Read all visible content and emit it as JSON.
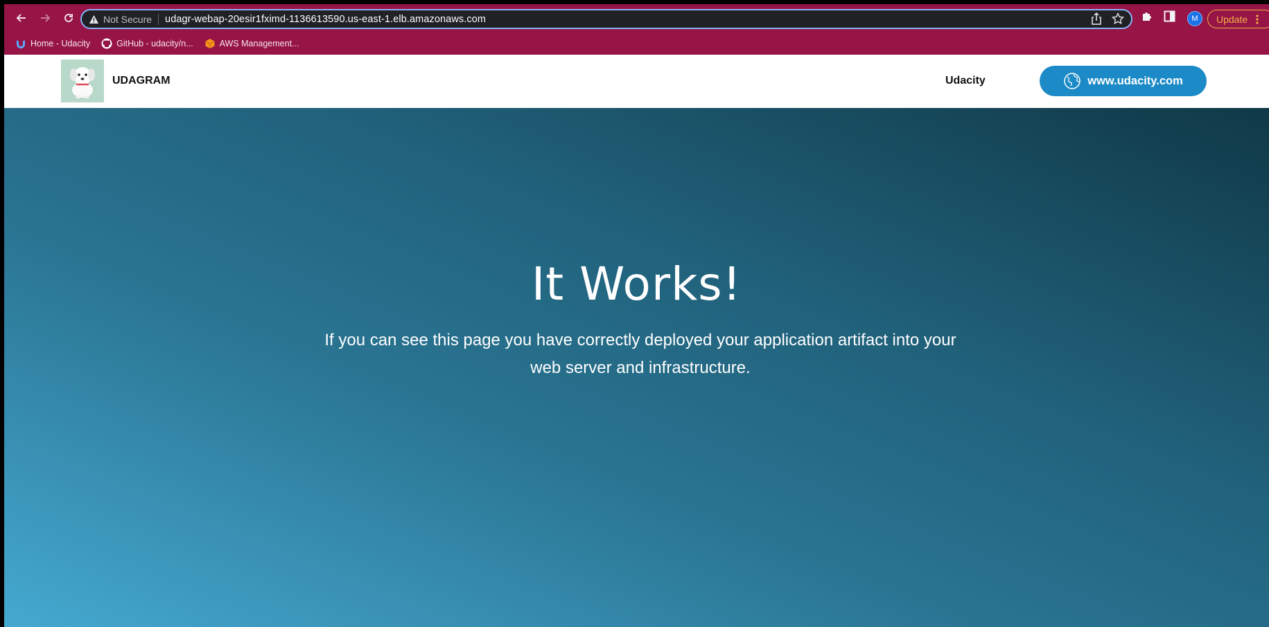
{
  "browser": {
    "security_label": "Not Secure",
    "url": "udagr-webap-20esir1fximd-1136613590.us-east-1.elb.amazonaws.com",
    "profile_initial": "M",
    "update_label": "Update",
    "bookmarks": [
      {
        "label": "Home - Udacity",
        "icon": "udacity-icon"
      },
      {
        "label": "GitHub - udacity/n...",
        "icon": "github-icon"
      },
      {
        "label": "AWS Management...",
        "icon": "aws-cube-icon"
      }
    ]
  },
  "site": {
    "brand": "UDAGRAM",
    "nav_link": "Udacity",
    "cta_label": "www.udacity.com"
  },
  "hero": {
    "title": "It Works!",
    "text": "If you can see this page you have correctly deployed your application artifact into your web server and infrastructure."
  },
  "colors": {
    "browser_frame": "#961446",
    "cta": "#1b8ac6",
    "update_accent": "#f2b545"
  }
}
